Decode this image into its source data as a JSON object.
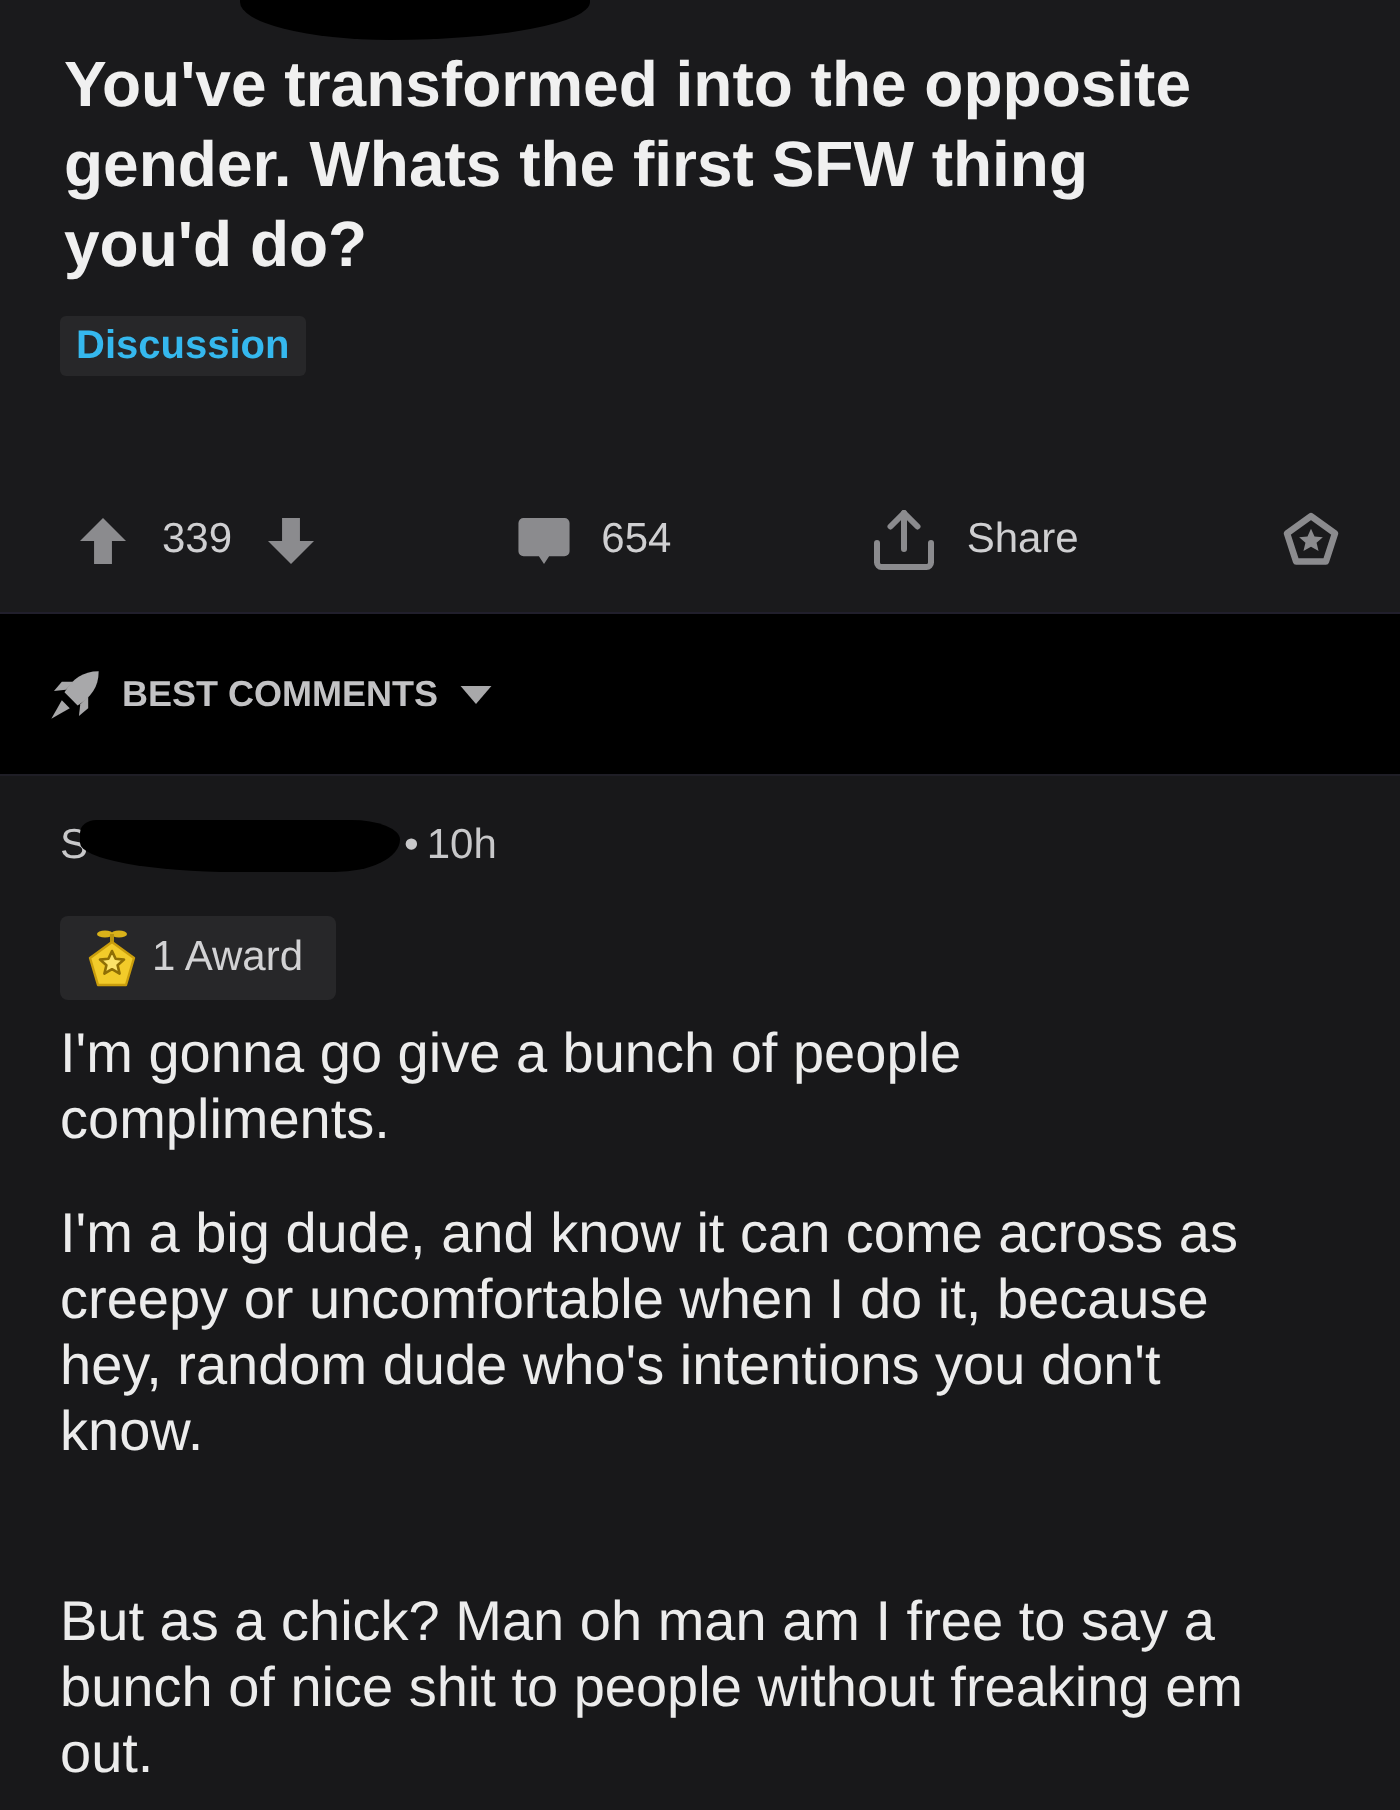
{
  "post": {
    "title": "You've transformed into the opposite gender. Whats the first SFW thing you'd do?",
    "flair": "Discussion",
    "score": "339",
    "comments_count": "654",
    "share_label": "Share"
  },
  "sort": {
    "label": "BEST COMMENTS"
  },
  "comment": {
    "author": "S",
    "separator": "•",
    "time": "10h",
    "awards": "1 Award",
    "paragraphs": [
      "I'm gonna go give a bunch of people compliments.",
      "I'm a big dude, and know it can come across as creepy or uncomfortable when I do it, because hey, random dude who's intentions you don't know.",
      "But as a chick? Man oh man am I free to say a bunch of nice shit to people without freaking em out."
    ]
  }
}
